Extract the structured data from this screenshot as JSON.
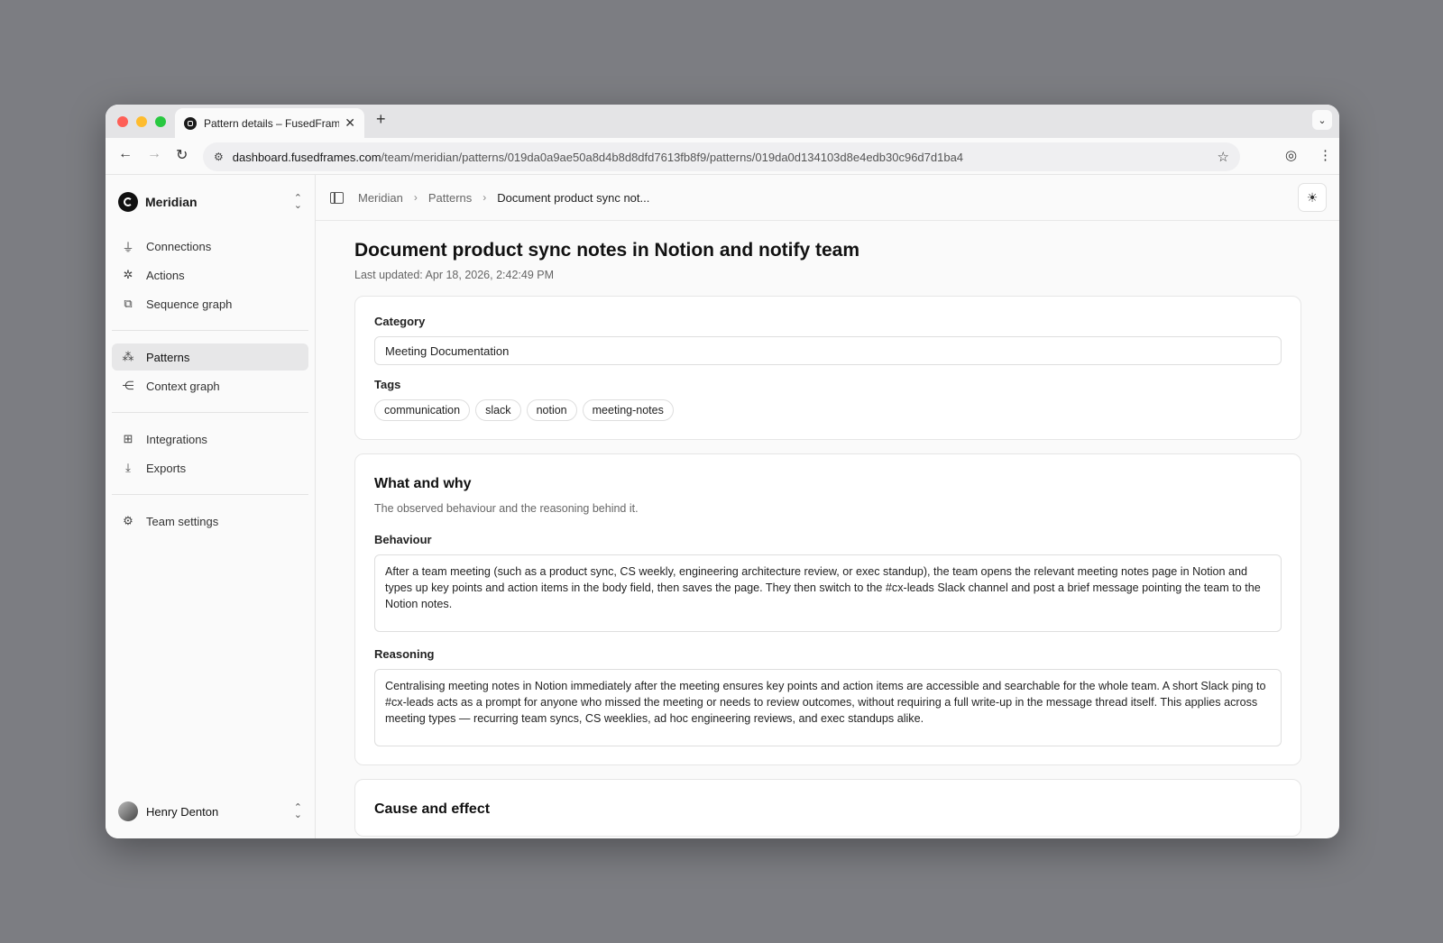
{
  "browser": {
    "tab_title": "Pattern details – FusedFrames",
    "new_tab": "+",
    "url_host": "dashboard.fusedframes.com",
    "url_path": "/team/meridian/patterns/019da0a9ae50a8d4b8d8dfd7613fb8f9/patterns/019da0d134103d8e4edb30c96d7d1ba4"
  },
  "sidebar": {
    "team_name": "Meridian",
    "groups": [
      [
        {
          "label": "Connections",
          "icon": "plug-icon"
        },
        {
          "label": "Actions",
          "icon": "sparkle-click-icon"
        },
        {
          "label": "Sequence graph",
          "icon": "sequence-icon"
        }
      ],
      [
        {
          "label": "Patterns",
          "icon": "pattern-icon",
          "active": true
        },
        {
          "label": "Context graph",
          "icon": "share-graph-icon"
        }
      ],
      [
        {
          "label": "Integrations",
          "icon": "integrations-icon"
        },
        {
          "label": "Exports",
          "icon": "download-icon"
        }
      ],
      [
        {
          "label": "Team settings",
          "icon": "gear-icon"
        }
      ]
    ],
    "user_name": "Henry Denton"
  },
  "breadcrumb": {
    "items": [
      "Meridian",
      "Patterns"
    ],
    "current": "Document product sync not..."
  },
  "page": {
    "title": "Document product sync notes in Notion and notify team",
    "last_updated": "Last updated: Apr 18, 2026, 2:42:49 PM"
  },
  "details": {
    "category_label": "Category",
    "category_value": "Meeting Documentation",
    "tags_label": "Tags",
    "tags": [
      "communication",
      "slack",
      "notion",
      "meeting-notes"
    ]
  },
  "what_why": {
    "title": "What and why",
    "subtitle": "The observed behaviour and the reasoning behind it.",
    "behaviour_label": "Behaviour",
    "behaviour_text": "After a team meeting (such as a product sync, CS weekly, engineering architecture review, or exec standup), the team opens the relevant meeting notes page in Notion and types up key points and action items in the body field, then saves the page. They then switch to the #cx-leads Slack channel and post a brief message pointing the team to the Notion notes.",
    "reasoning_label": "Reasoning",
    "reasoning_text": "Centralising meeting notes in Notion immediately after the meeting ensures key points and action items are accessible and searchable for the whole team. A short Slack ping to #cx-leads acts as a prompt for anyone who missed the meeting or needs to review outcomes, without requiring a full write-up in the message thread itself. This applies across meeting types — recurring team syncs, CS weeklies, ad hoc engineering reviews, and exec standups alike."
  },
  "cause_effect": {
    "title": "Cause and effect"
  }
}
